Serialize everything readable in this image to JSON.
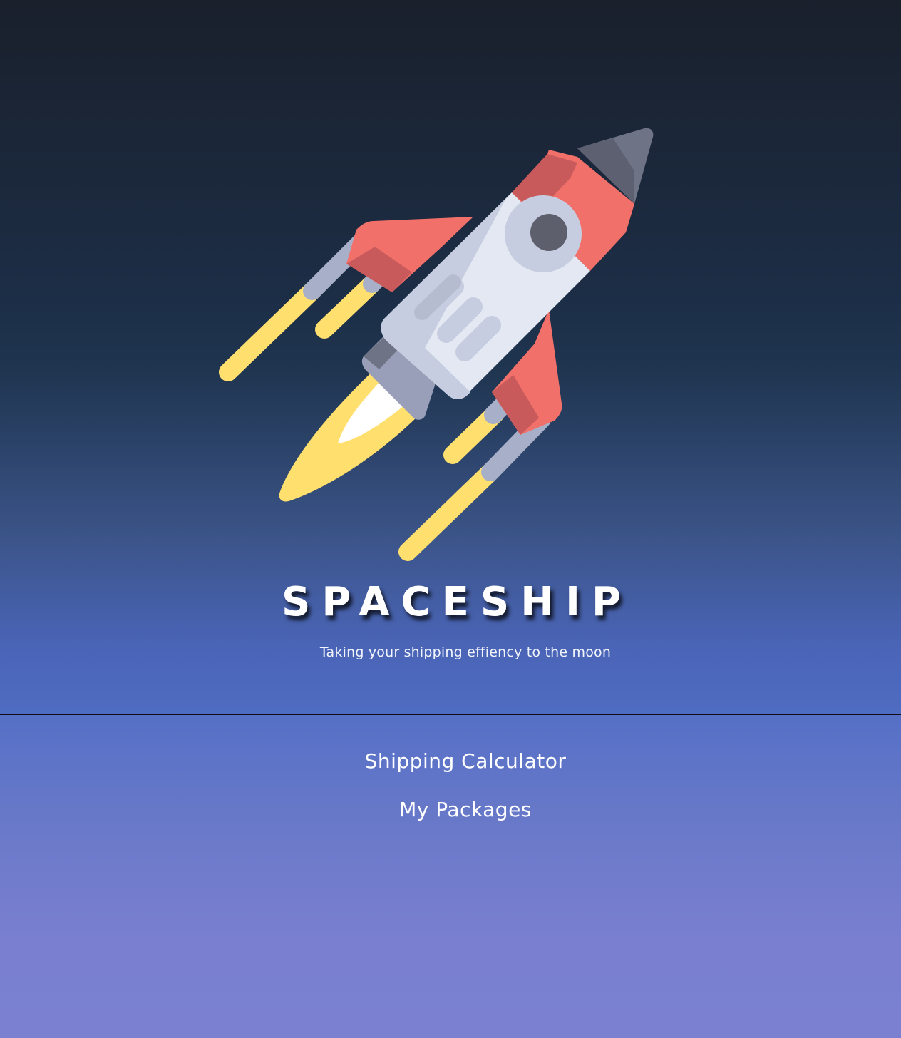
{
  "hero": {
    "logo_icon": "rocket-icon",
    "title": "SPACESHIP",
    "tagline": "Taking your shipping effiency to the moon"
  },
  "nav": {
    "items": [
      {
        "label": "Shipping Calculator"
      },
      {
        "label": "My Packages"
      }
    ]
  },
  "colors": {
    "hero_top": "#1a202c",
    "hero_bottom": "#4e6cc2",
    "lower_top": "#5570c6",
    "lower_bottom": "#7b80d0",
    "rocket_red": "#f2706a",
    "rocket_body": "#e4e8f2",
    "flame_yellow": "#ffe070"
  }
}
